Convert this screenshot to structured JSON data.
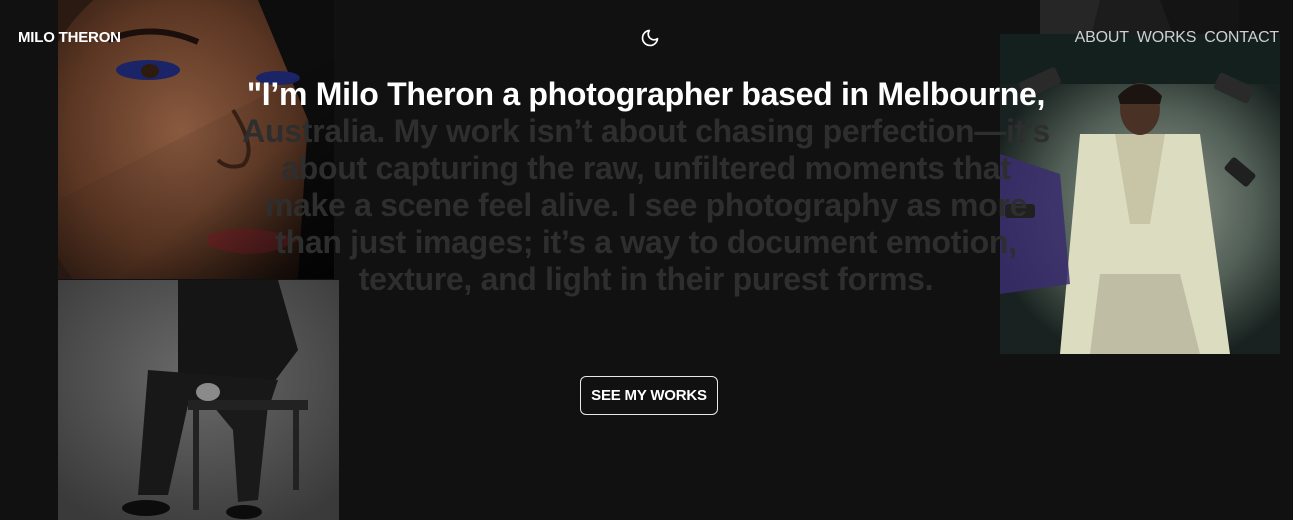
{
  "header": {
    "brand": "MILO THERON",
    "theme_toggle_icon": "moon-icon",
    "nav": [
      {
        "label": "ABOUT"
      },
      {
        "label": "WORKS"
      },
      {
        "label": "CONTACT"
      }
    ]
  },
  "hero": {
    "statement_highlighted": "\"I’m Milo Theron a photographer based in Melbourne,",
    "statement_faded": " Australia. My work isn’t about chasing perfection—it’s about capturing the raw, unfiltered moments that make a scene feel alive. I see photography as more than just images; it’s a way to document emotion, texture, and light in their purest forms.",
    "cta_label": "SEE MY WORKS"
  },
  "photos": [
    {
      "subject": "close-up portrait of a woman with blue eyeshadow"
    },
    {
      "subject": "black and white photo of a person seated on a chair"
    },
    {
      "subject": "dark abstract detail"
    },
    {
      "subject": "woman in a cream suit surrounded by phones"
    }
  ],
  "colors": {
    "background": "#111111",
    "text_primary": "#ffffff",
    "text_faded": "#2e2e2e",
    "nav_text": "#cfcfcf"
  }
}
